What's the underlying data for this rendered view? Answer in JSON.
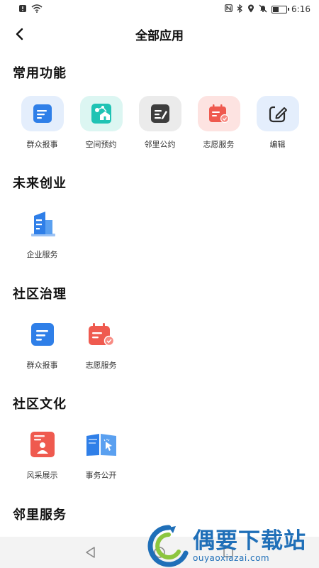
{
  "status_bar": {
    "time": "6:16",
    "battery_level": 0.45,
    "icons_left": [
      "notification-icon",
      "wifi-icon"
    ],
    "icons_right": [
      "nfc-icon",
      "bluetooth-icon",
      "location-icon",
      "mute-icon",
      "battery-icon"
    ]
  },
  "header": {
    "title": "全部应用",
    "back_icon": "chevron-left-icon"
  },
  "sections": [
    {
      "title": "常用功能",
      "items": [
        {
          "label": "群众报事",
          "icon": "report-icon"
        },
        {
          "label": "空间预约",
          "icon": "space-booking-icon"
        },
        {
          "label": "邻里公约",
          "icon": "convention-icon"
        },
        {
          "label": "志愿服务",
          "icon": "volunteer-icon"
        },
        {
          "label": "编辑",
          "icon": "edit-icon"
        }
      ]
    },
    {
      "title": "未来创业",
      "items": [
        {
          "label": "企业服务",
          "icon": "enterprise-icon"
        }
      ]
    },
    {
      "title": "社区治理",
      "items": [
        {
          "label": "群众报事",
          "icon": "report-icon"
        },
        {
          "label": "志愿服务",
          "icon": "volunteer-icon"
        }
      ]
    },
    {
      "title": "社区文化",
      "items": [
        {
          "label": "风采展示",
          "icon": "showcase-icon"
        },
        {
          "label": "事务公开",
          "icon": "affairs-icon"
        }
      ]
    },
    {
      "title": "邻里服务",
      "items": []
    }
  ],
  "bottom_nav": {
    "keys": [
      "back-triangle-icon",
      "home-circle-icon",
      "recents-square-icon"
    ]
  },
  "watermark": {
    "cn": "偶要下载站",
    "en": "ouyaoxiazai.com"
  },
  "colors": {
    "blue": "#2f7fe8",
    "teal": "#1fc3b4",
    "dark": "#3d3d3d",
    "red": "#ef5a4f",
    "watermark": "#1f6fb8"
  }
}
